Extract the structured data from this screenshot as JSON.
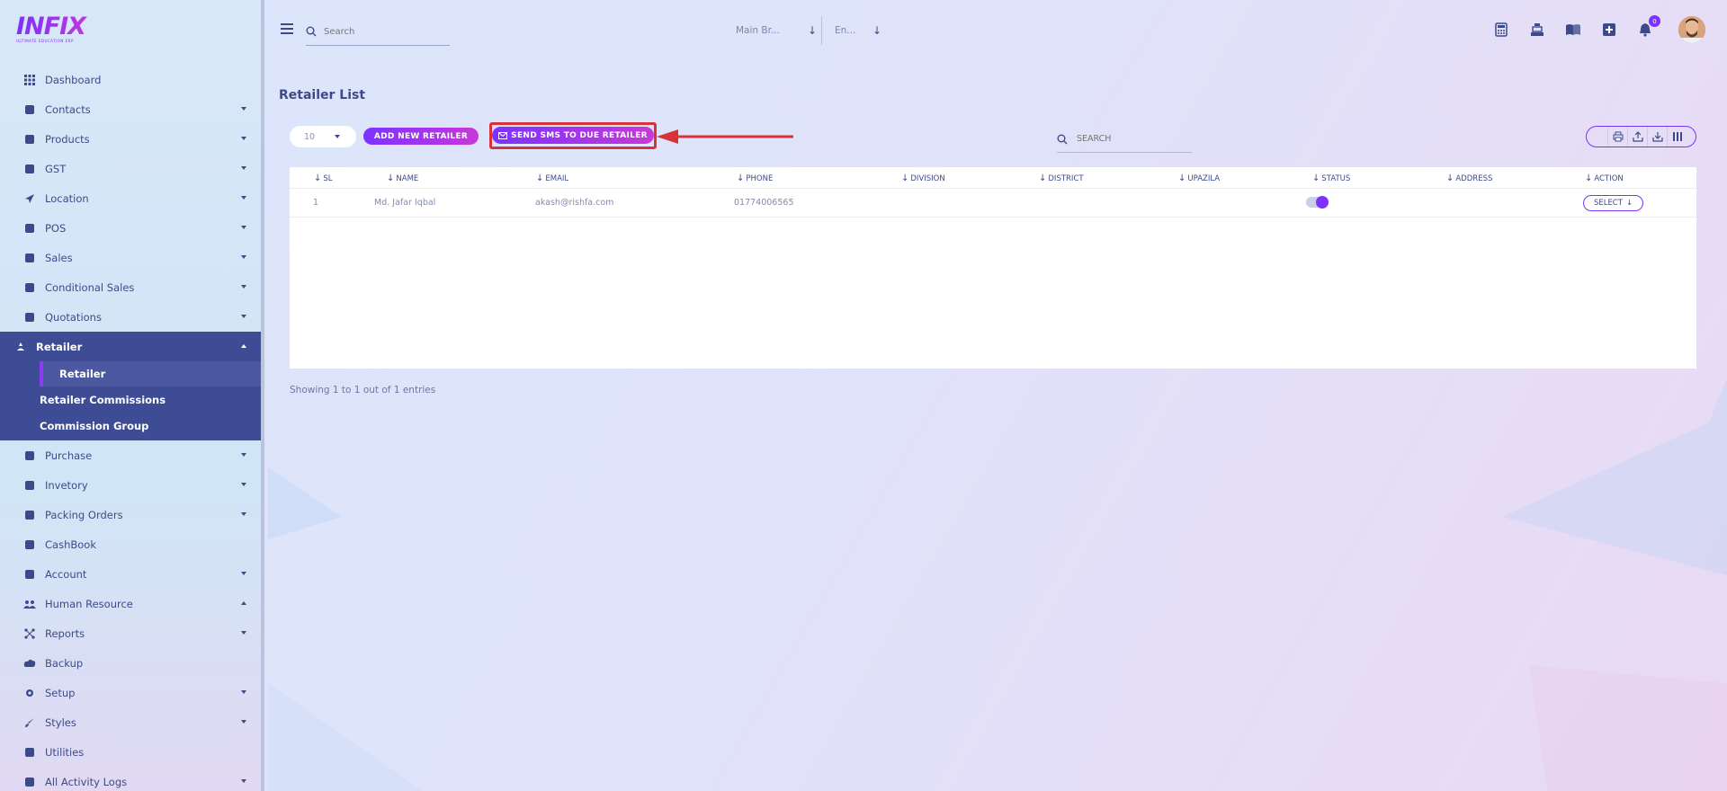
{
  "app": {
    "logo_text": "INFIX",
    "logo_sub": "ULTIMATE EDUCATION ERP"
  },
  "colors": {
    "primary": "#7c32ff",
    "secondary": "#c738d8",
    "sidebar_active": "#3e4c96",
    "highlight": "#d8333a"
  },
  "sidebar": {
    "items": [
      {
        "label": "Dashboard",
        "icon": "grid-icon",
        "caret": ""
      },
      {
        "label": "Contacts",
        "icon": "contacts-icon",
        "caret": "down"
      },
      {
        "label": "Products",
        "icon": "products-icon",
        "caret": "down"
      },
      {
        "label": "GST",
        "icon": "gst-icon",
        "caret": "down"
      },
      {
        "label": "Location",
        "icon": "location-icon",
        "caret": "down"
      },
      {
        "label": "POS",
        "icon": "pos-icon",
        "caret": "down"
      },
      {
        "label": "Sales",
        "icon": "sales-icon",
        "caret": "down"
      },
      {
        "label": "Conditional Sales",
        "icon": "gavel-icon",
        "caret": "down"
      },
      {
        "label": "Quotations",
        "icon": "quotation-icon",
        "caret": "down"
      }
    ],
    "retailer_group": {
      "label": "Retailer",
      "icon": "retailer-icon",
      "sub": [
        "Retailer",
        "Retailer Commissions",
        "Commission Group"
      ]
    },
    "items_after": [
      {
        "label": "Purchase",
        "icon": "purchase-icon",
        "caret": "down"
      },
      {
        "label": "Invetory",
        "icon": "inventory-icon",
        "caret": "down"
      },
      {
        "label": "Packing Orders",
        "icon": "packing-icon",
        "caret": "down"
      },
      {
        "label": "CashBook",
        "icon": "cashbook-icon",
        "caret": ""
      },
      {
        "label": "Account",
        "icon": "account-icon",
        "caret": "down"
      },
      {
        "label": "Human Resource",
        "icon": "users-icon",
        "caret": "up"
      },
      {
        "label": "Reports",
        "icon": "reports-icon",
        "caret": "down"
      },
      {
        "label": "Backup",
        "icon": "backup-icon",
        "caret": ""
      },
      {
        "label": "Setup",
        "icon": "gear-icon",
        "caret": "down"
      },
      {
        "label": "Styles",
        "icon": "brush-icon",
        "caret": "down"
      },
      {
        "label": "Utilities",
        "icon": "utilities-icon",
        "caret": ""
      },
      {
        "label": "All Activity Logs",
        "icon": "logs-icon",
        "caret": "down"
      }
    ]
  },
  "topbar": {
    "search_placeholder": "Search",
    "branch": "Main Br...",
    "language": "En...",
    "notification_count": "0",
    "icons": [
      "calculator-icon",
      "cash-register-icon",
      "book-icon",
      "plus-square-icon",
      "bell-icon"
    ]
  },
  "main": {
    "title": "Retailer List",
    "per_page": "10",
    "add_button": "ADD NEW RETAILER",
    "sms_button": "SEND SMS TO DUE RETAILER",
    "search_placeholder": "SEARCH",
    "tools": [
      "print-icon",
      "export-icon",
      "download-icon",
      "columns-icon"
    ],
    "columns": [
      "SL",
      "NAME",
      "EMAIL",
      "PHONE",
      "DIVISION",
      "DISTRICT",
      "UPAZILA",
      "STATUS",
      "ADDRESS",
      "ACTION"
    ],
    "rows": [
      {
        "sl": "1",
        "name": "Md. Jafar Iqbal",
        "email": "akash@rishfa.com",
        "phone": "01774006565",
        "division": "",
        "district": "",
        "upazila": "",
        "status": "on",
        "address": "",
        "action": "SELECT"
      }
    ],
    "entries_text": "Showing 1 to 1 out of 1 entries"
  }
}
